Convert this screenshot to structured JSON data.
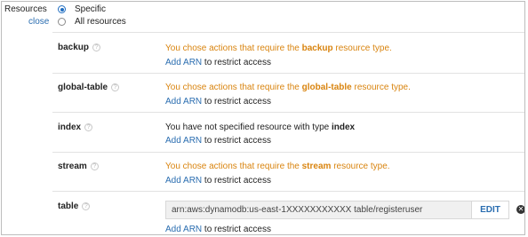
{
  "resources_label": "Resources",
  "close_label": "close",
  "scope_options": [
    {
      "label": "Specific",
      "selected": true
    },
    {
      "label": "All resources",
      "selected": false
    }
  ],
  "resource_types": [
    {
      "name": "backup",
      "msg_pre": "You chose actions that require the ",
      "msg_bold": "backup",
      "msg_post": " resource type.",
      "msg_style": "warning"
    },
    {
      "name": "global-table",
      "msg_pre": "You chose actions that require the ",
      "msg_bold": "global-table",
      "msg_post": " resource type.",
      "msg_style": "warning"
    },
    {
      "name": "index",
      "msg_pre": "You have not specified resource with type ",
      "msg_bold": "index",
      "msg_post": "",
      "msg_style": "plain"
    },
    {
      "name": "stream",
      "msg_pre": "You chose actions that require the ",
      "msg_bold": "stream",
      "msg_post": " resource type.",
      "msg_style": "warning"
    },
    {
      "name": "table",
      "arn_value": "arn:aws:dynamodb:us-east-1XXXXXXXXXXX table/registeruser",
      "edit_label": "EDIT"
    }
  ],
  "add_arn_link": "Add ARN",
  "add_arn_suffix": " to restrict access",
  "help_glyph": "?",
  "remove_glyph": "✕",
  "colors": {
    "warning": "#d9840f",
    "link": "#2a6db0",
    "radio": "#1f6dc1"
  }
}
